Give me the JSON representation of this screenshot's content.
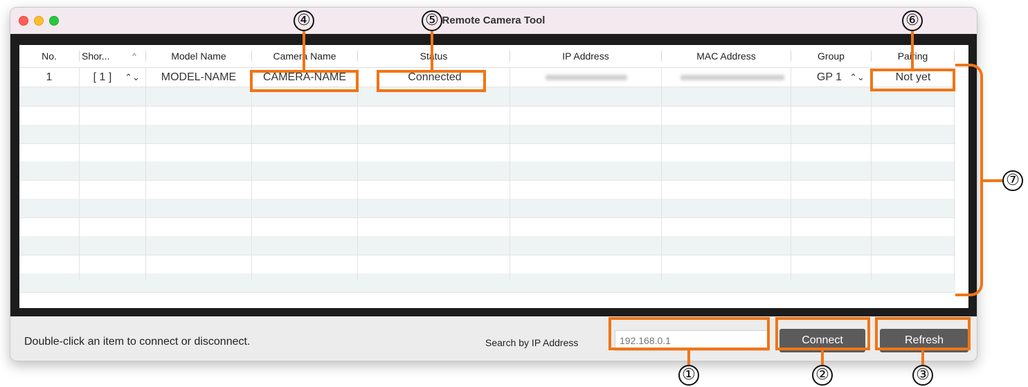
{
  "window": {
    "title": "Remote Camera Tool"
  },
  "table": {
    "columns": [
      "No.",
      "Shor...",
      "Model Name",
      "Camera Name",
      "Status",
      "IP Address",
      "MAC Address",
      "Group",
      "Pairing"
    ],
    "sort_indicator": "^",
    "rows": [
      {
        "no": "1",
        "shortcut": "[ 1 ]",
        "model": "MODEL-NAME",
        "camera": "CAMERA-NAME",
        "status": "Connected",
        "group": "GP 1",
        "pairing": "Not yet"
      }
    ],
    "stepper_glyph": "⌃⌄"
  },
  "footer": {
    "hint": "Double-click an item to connect or disconnect.",
    "search_label": "Search by IP Address",
    "search_placeholder": "192.168.0.1",
    "connect_label": "Connect",
    "refresh_label": "Refresh"
  },
  "callouts": [
    "①",
    "②",
    "③",
    "④",
    "⑤",
    "⑥",
    "⑦"
  ],
  "colors": {
    "accent": "#f07516",
    "button": "#5b5b5b",
    "row_alt": "#eef3f3"
  }
}
